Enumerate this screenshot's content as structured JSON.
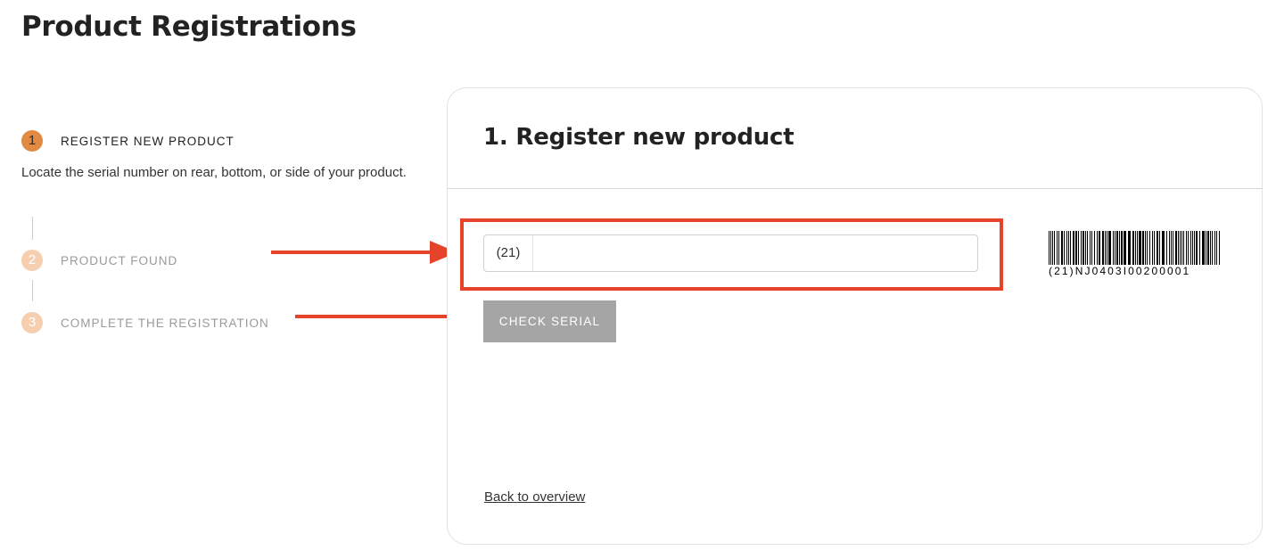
{
  "page": {
    "title": "Product Registrations"
  },
  "steps": [
    {
      "number": "1",
      "label": "REGISTER NEW PRODUCT",
      "state": "active"
    },
    {
      "number": "2",
      "label": "PRODUCT FOUND",
      "state": "inactive"
    },
    {
      "number": "3",
      "label": "COMPLETE THE REGISTRATION",
      "state": "inactive"
    }
  ],
  "step_description": "Locate the serial number on rear, bottom, or side of your product.",
  "card": {
    "title": "1. Register new product",
    "serial": {
      "prefix": "(21)",
      "value": "",
      "placeholder": ""
    },
    "check_button_label": "CHECK SERIAL",
    "barcode_text": "(21)NJ0403I00200001",
    "back_link": "Back to overview"
  },
  "colors": {
    "accent": "#e08a43",
    "accent_light": "#f5cfb0",
    "annotation_red": "#e5432a",
    "button_disabled": "#a5a5a5"
  },
  "icons": {
    "annotation_arrow": "arrow-right-icon",
    "barcode": "barcode-image"
  }
}
